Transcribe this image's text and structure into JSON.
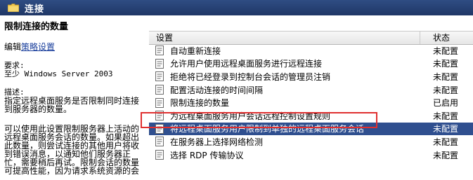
{
  "header": {
    "title": "连接"
  },
  "left": {
    "heading": "限制连接的数量",
    "edit_prefix": "编辑",
    "edit_link": "策略设置",
    "req_label": "要求:",
    "req_value": "至少 Windows Server 2003",
    "desc_label": "描述:",
    "desc_p1_l1": "指定远程桌面服务是否限制同时连接",
    "desc_p1_l2": "到服务器的数量。",
    "desc_p2_l1": "可以使用此设置限制服务器上活动的",
    "desc_p2_l2": "远程桌面服务会话的数量。如果超出",
    "desc_p2_l3": "此数量，则尝试连接的其他用户将收",
    "desc_p2_l4": "到错误消息，以通知他们服务器正",
    "desc_p2_l5": "忙，需要稍后再试。限制会话的数量",
    "desc_p2_l6": "可提高性能，因为请求系统资源的会"
  },
  "table": {
    "col_setting": "设置",
    "col_state": "状态",
    "rows": [
      {
        "name": "自动重新连接",
        "state": "未配置"
      },
      {
        "name": "允许用户使用远程桌面服务进行远程连接",
        "state": "未配置"
      },
      {
        "name": "拒绝将已经登录到控制台会话的管理员注销",
        "state": "未配置"
      },
      {
        "name": "配置活动连接的时间间隔",
        "state": "未配置"
      },
      {
        "name": "限制连接的数量",
        "state": "已启用"
      },
      {
        "name": "为远程桌面服务用户会话远程控制设置规则",
        "state": "未配置"
      },
      {
        "name": "将远程桌面服务用户限制到单独的远程桌面服务会话",
        "state": "未配置"
      },
      {
        "name": "在服务器上选择网络检测",
        "state": "未配置"
      },
      {
        "name": "选择 RDP 传输协议",
        "state": "未配置"
      }
    ]
  },
  "colors": {
    "titlebar": "#1f3766",
    "selected_row": "#2f4f8f",
    "highlight": "#e03030",
    "link": "#1a3f9c"
  },
  "icons": {
    "folder": "folder-icon",
    "policy": "policy-setting-icon"
  }
}
